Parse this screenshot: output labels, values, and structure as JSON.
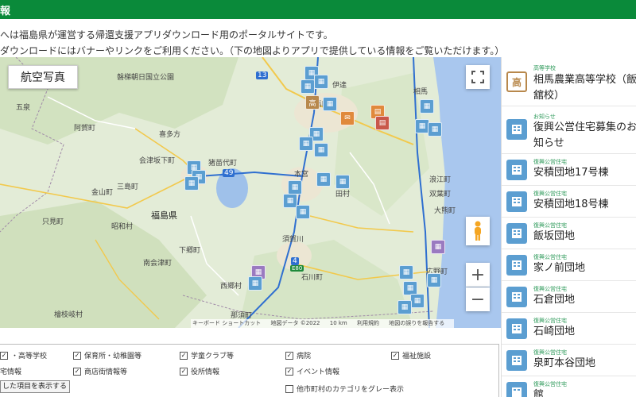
{
  "header": {
    "title": "報"
  },
  "intro": {
    "line1": "へは福島県が運営する帰還支援アプリダウンロード用のポータルサイトです。",
    "line2": "ダウンロードにはバナーやリンクをご利用ください。（下の地図よりアプリで提供している情報をご覧いただけます。）"
  },
  "map": {
    "aerial_label": "航空写真",
    "fullscreen_icon": "fullscreen-icon",
    "pegman_icon": "pegman-icon",
    "zoom_in_label": "+",
    "zoom_out_label": "−",
    "attribution": {
      "shortcuts": "キーボード ショートカット",
      "mapdata": "地図データ ©2022",
      "scale": "10 km",
      "terms": "利用規約",
      "report": "地図の誤りを報告する"
    },
    "places": [
      {
        "name": "磐梯朝日国立公園",
        "line2": ""
      },
      {
        "name": "喜多方",
        "line2": ""
      },
      {
        "name": "会津坂下町",
        "line2": ""
      },
      {
        "name": "猪苗代町",
        "line2": ""
      },
      {
        "name": "三島町",
        "line2": ""
      },
      {
        "name": "金山町",
        "line2": ""
      },
      {
        "name": "福島県",
        "line2": ""
      },
      {
        "name": "只見町",
        "line2": ""
      },
      {
        "name": "昭和村",
        "line2": ""
      },
      {
        "name": "南会津町",
        "line2": ""
      },
      {
        "name": "下郷町",
        "line2": ""
      },
      {
        "name": "西郷村",
        "line2": ""
      },
      {
        "name": "那須町",
        "line2": ""
      },
      {
        "name": "檜枝岐村",
        "line2": ""
      },
      {
        "name": "阿賀町",
        "line2": ""
      },
      {
        "name": "五泉",
        "line2": ""
      },
      {
        "name": "伊達",
        "line2": ""
      },
      {
        "name": "本宮",
        "line2": ""
      },
      {
        "name": "田村",
        "line2": ""
      },
      {
        "name": "須賀川",
        "line2": ""
      },
      {
        "name": "石川町",
        "line2": ""
      },
      {
        "name": "浪江町",
        "line2": ""
      },
      {
        "name": "双葉町",
        "line2": ""
      },
      {
        "name": "大熊町",
        "line2": ""
      },
      {
        "name": "広野町",
        "line2": ""
      },
      {
        "name": "相馬",
        "line2": ""
      },
      {
        "name": "福島",
        "line2": ""
      }
    ],
    "marker_icons": {
      "housing": "apartment-icon",
      "school": "school-icon",
      "shop": "shop-icon",
      "event": "event-icon"
    },
    "route_labels": [
      "13",
      "49",
      "4",
      "E80"
    ]
  },
  "filters": {
    "items": [
      {
        "label": "・高等学校",
        "checked": true
      },
      {
        "label": "保育所・幼稚園等",
        "checked": true
      },
      {
        "label": "学童クラブ等",
        "checked": true
      },
      {
        "label": "病院",
        "checked": true
      },
      {
        "label": "福祉施設",
        "checked": true
      },
      {
        "label": "宅情報",
        "checked": true
      },
      {
        "label": "商店街情報等",
        "checked": true
      },
      {
        "label": "役所情報",
        "checked": true
      },
      {
        "label": "イベント情報",
        "checked": true
      },
      {
        "label": "他市町村のカテゴリをグレー表示",
        "checked": false
      }
    ],
    "show_button": "した項目を表示する"
  },
  "side": {
    "items": [
      {
        "category": "高等学校",
        "name": "相馬農業高等学校（飯",
        "name2": "舘校）",
        "icon": "school-icon"
      },
      {
        "category": "お知らせ",
        "name": "復興公営住宅募集のお",
        "name2": "知らせ",
        "icon": "apartment-icon"
      },
      {
        "category": "復興公営住宅",
        "name": "安積団地17号棟",
        "icon": "apartment-icon"
      },
      {
        "category": "復興公営住宅",
        "name": "安積団地18号棟",
        "icon": "apartment-icon"
      },
      {
        "category": "復興公営住宅",
        "name": "飯坂団地",
        "icon": "apartment-icon"
      },
      {
        "category": "復興公営住宅",
        "name": "家ノ前団地",
        "icon": "apartment-icon"
      },
      {
        "category": "復興公営住宅",
        "name": "石倉団地",
        "icon": "apartment-icon"
      },
      {
        "category": "復興公営住宅",
        "name": "石崎団地",
        "icon": "apartment-icon"
      },
      {
        "category": "復興公営住宅",
        "name": "泉町本谷団地",
        "icon": "apartment-icon"
      },
      {
        "category": "復興公営住宅",
        "name": "館",
        "icon": "apartment-icon"
      }
    ]
  },
  "colors": {
    "header_green": "#0a8a3a",
    "housing_blue": "#5b9ed1",
    "school_brown": "#b8884c",
    "shop_orange": "#e0893c"
  }
}
